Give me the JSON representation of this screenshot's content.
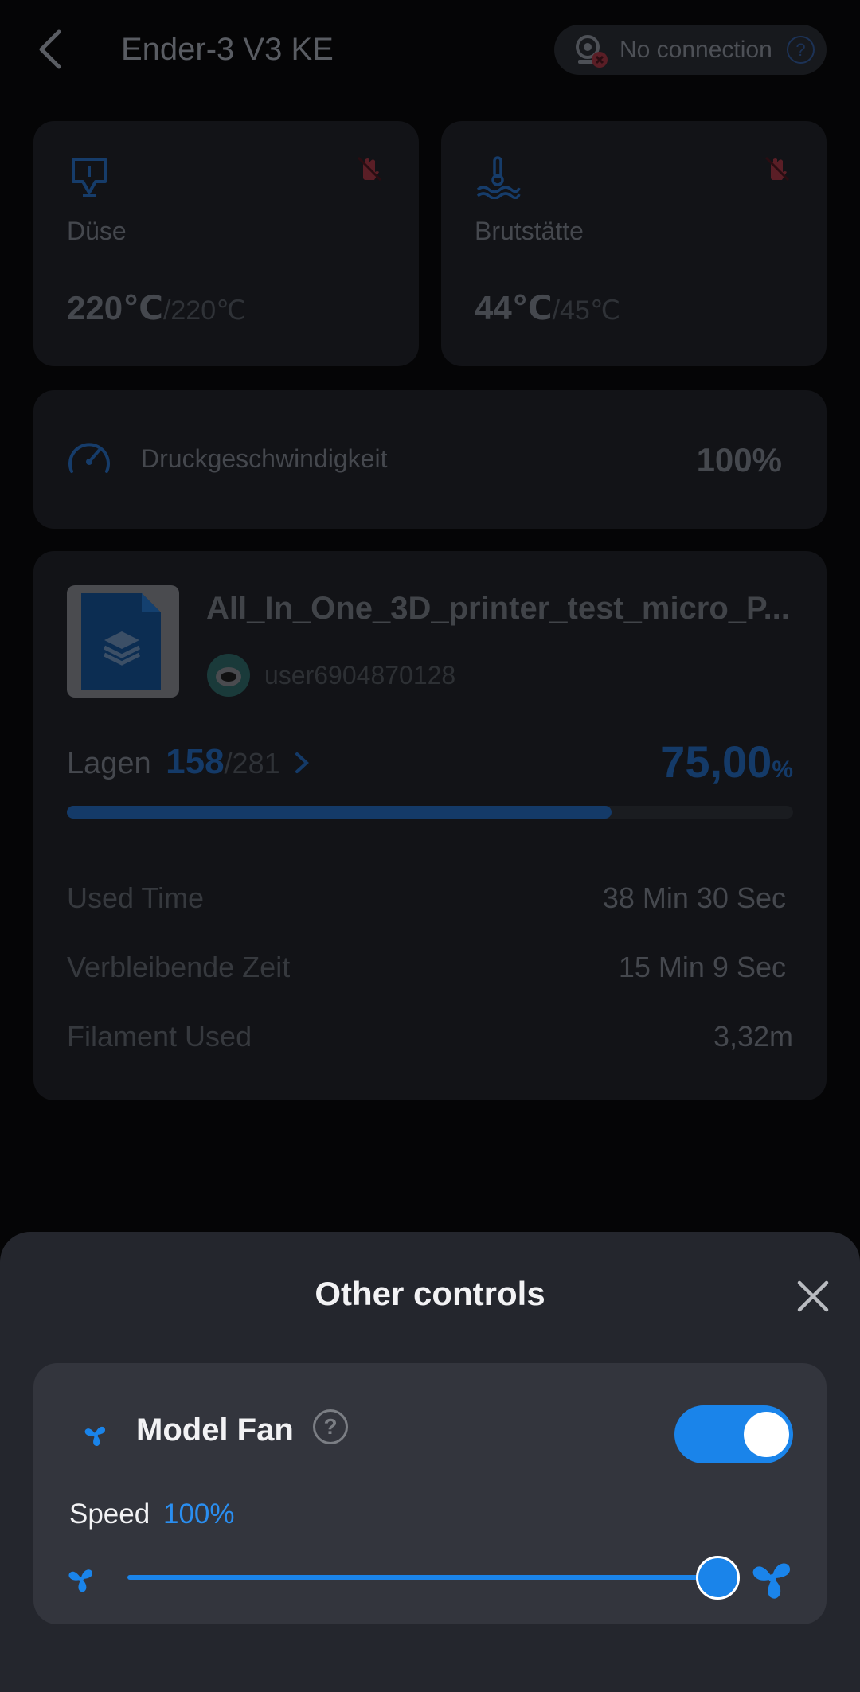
{
  "header": {
    "title": "Ender-3 V3 KE",
    "connection_status": "No connection",
    "help_glyph": "?"
  },
  "temperatures": [
    {
      "label": "Düse",
      "current": "220℃",
      "target": "/220℃",
      "icon": "nozzle-icon"
    },
    {
      "label": "Brutstätte",
      "current": "44℃",
      "target": "/45℃",
      "icon": "bed-heat-icon"
    }
  ],
  "print_speed": {
    "label": "Druckgeschwindigkeit",
    "value": "100%"
  },
  "job": {
    "file_name": "All_In_One_3D_printer_test_micro_P...",
    "user": "user6904870128",
    "layers_label": "Lagen",
    "layer_current": "158",
    "layer_total": "/281",
    "progress_value": "75,00",
    "progress_unit": "%",
    "progress_fraction": 0.75,
    "stats": [
      {
        "label": "Used Time",
        "value": "38 Min  30 Sec"
      },
      {
        "label": "Verbleibende Zeit",
        "value": "15 Min  9 Sec"
      },
      {
        "label": "Filament Used",
        "value": "3,32m"
      }
    ]
  },
  "sheet": {
    "title": "Other controls",
    "fan": {
      "name": "Model Fan",
      "help_glyph": "?",
      "enabled": true,
      "speed_label": "Speed",
      "speed_value": "100%",
      "speed_fraction": 1.0
    }
  },
  "colors": {
    "accent": "#1a84ea",
    "sheet_bg": "#24262d",
    "card_bg": "#33353d",
    "warning_red": "#5a1e26"
  }
}
